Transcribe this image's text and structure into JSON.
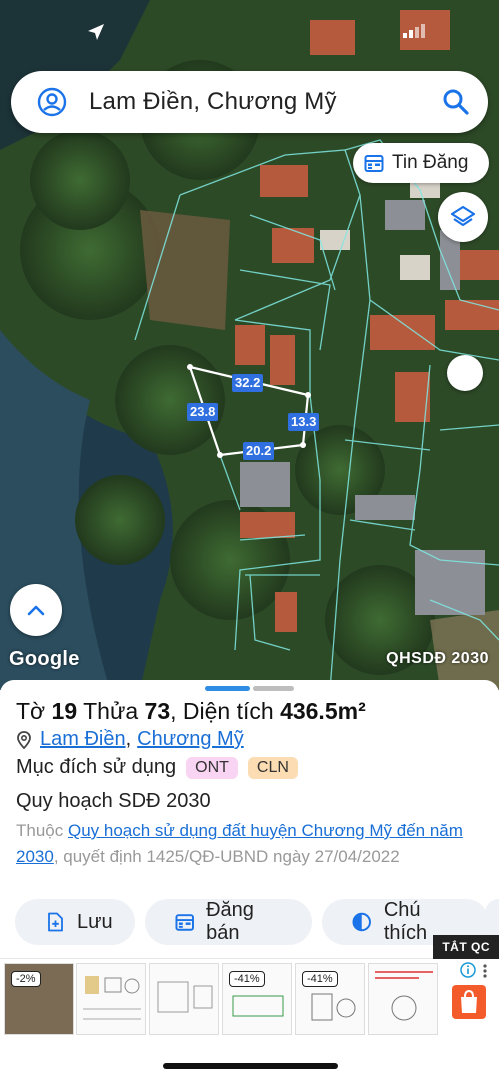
{
  "map": {
    "search_query": "Lam Điền, Chương Mỹ",
    "tin_dang_label": "Tin Đăng",
    "google_logo": "Google",
    "layer_label": "QHSDĐ 2030",
    "dimensions": [
      "32.2",
      "23.8",
      "13.3",
      "20.2"
    ]
  },
  "parcel": {
    "title_prefix": "Tờ",
    "sheet_no": "19",
    "parcel_word": "Thửa",
    "parcel_no": "73",
    "area_label": ", Diện tích",
    "area_value": "436.5m²",
    "commune": "Lam Điền",
    "district": "Chương Mỹ",
    "purpose_label": "Mục đích sử dụng",
    "purpose_tags": [
      "ONT",
      "CLN"
    ],
    "plan_title": "Quy hoạch SDĐ 2030",
    "plan_desc_prefix": "Thuộc",
    "plan_link": "Quy hoạch sử dụng đất huyện Chương Mỹ đến năm 2030",
    "plan_desc_suffix": ", quyết định 1425/QĐ-UBND ngày 27/04/2022"
  },
  "actions": [
    {
      "label": "Lưu",
      "icon": "file-add-icon"
    },
    {
      "label": "Đăng bán",
      "icon": "calendar-icon"
    },
    {
      "label": "Chú thích",
      "icon": "half-circle-icon"
    }
  ],
  "ad": {
    "close_label": "TẮT QC",
    "discounts": [
      "-2%",
      "",
      "",
      "-41%",
      "-41%",
      ""
    ]
  },
  "colors": {
    "accent": "#1a6fd6",
    "pager_active": "#2f8de4",
    "dimension_badge": "#2f6fe0",
    "tag_ont": "#fad4f3",
    "tag_cln": "#fbdcb3"
  }
}
